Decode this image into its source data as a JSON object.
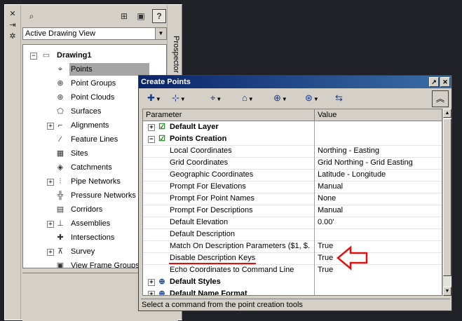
{
  "prospector": {
    "title": "Prospector",
    "view_select": {
      "value": "Active Drawing View"
    },
    "tree": {
      "root": "Drawing1",
      "items": [
        {
          "label": "Points",
          "selected": true
        },
        {
          "label": "Point Groups"
        },
        {
          "label": "Point Clouds"
        },
        {
          "label": "Surfaces"
        },
        {
          "label": "Alignments"
        },
        {
          "label": "Feature Lines"
        },
        {
          "label": "Sites"
        },
        {
          "label": "Catchments"
        },
        {
          "label": "Pipe Networks"
        },
        {
          "label": "Pressure Networks"
        },
        {
          "label": "Corridors"
        },
        {
          "label": "Assemblies"
        },
        {
          "label": "Intersections"
        },
        {
          "label": "Survey"
        },
        {
          "label": "View Frame Groups"
        }
      ]
    },
    "help_label": "?"
  },
  "dialog": {
    "title": "Create Points",
    "grid": {
      "headers": {
        "parameter": "Parameter",
        "value": "Value"
      },
      "rows": [
        {
          "name": "Default Layer",
          "value": "",
          "category": true,
          "expanded": false
        },
        {
          "name": "Points Creation",
          "value": "",
          "category": true,
          "expanded": true
        },
        {
          "name": "Local Coordinates",
          "value": "Northing - Easting"
        },
        {
          "name": "Grid Coordinates",
          "value": "Grid Northing - Grid Easting"
        },
        {
          "name": "Geographic Coordinates",
          "value": "Latitude - Longitude"
        },
        {
          "name": "Prompt For Elevations",
          "value": "Manual"
        },
        {
          "name": "Prompt For Point Names",
          "value": "None"
        },
        {
          "name": "Prompt For Descriptions",
          "value": "Manual"
        },
        {
          "name": "Default Elevation",
          "value": "0.00'"
        },
        {
          "name": "Default Description",
          "value": ""
        },
        {
          "name": "Match On Description Parameters ($1, $...",
          "value": "True"
        },
        {
          "name": "Disable Description Keys",
          "value": "True"
        },
        {
          "name": "Echo Coordinates to Command Line",
          "value": "True"
        },
        {
          "name": "Default Styles",
          "value": "",
          "category": true,
          "expanded": false
        },
        {
          "name": "Default Name Format",
          "value": "",
          "category": true,
          "expanded": false
        }
      ]
    },
    "status": "Select a command from the point creation tools"
  },
  "colors": {
    "title_bar": "#0a246a",
    "selection": "#a5a5a5",
    "annotation": "#e01010"
  }
}
